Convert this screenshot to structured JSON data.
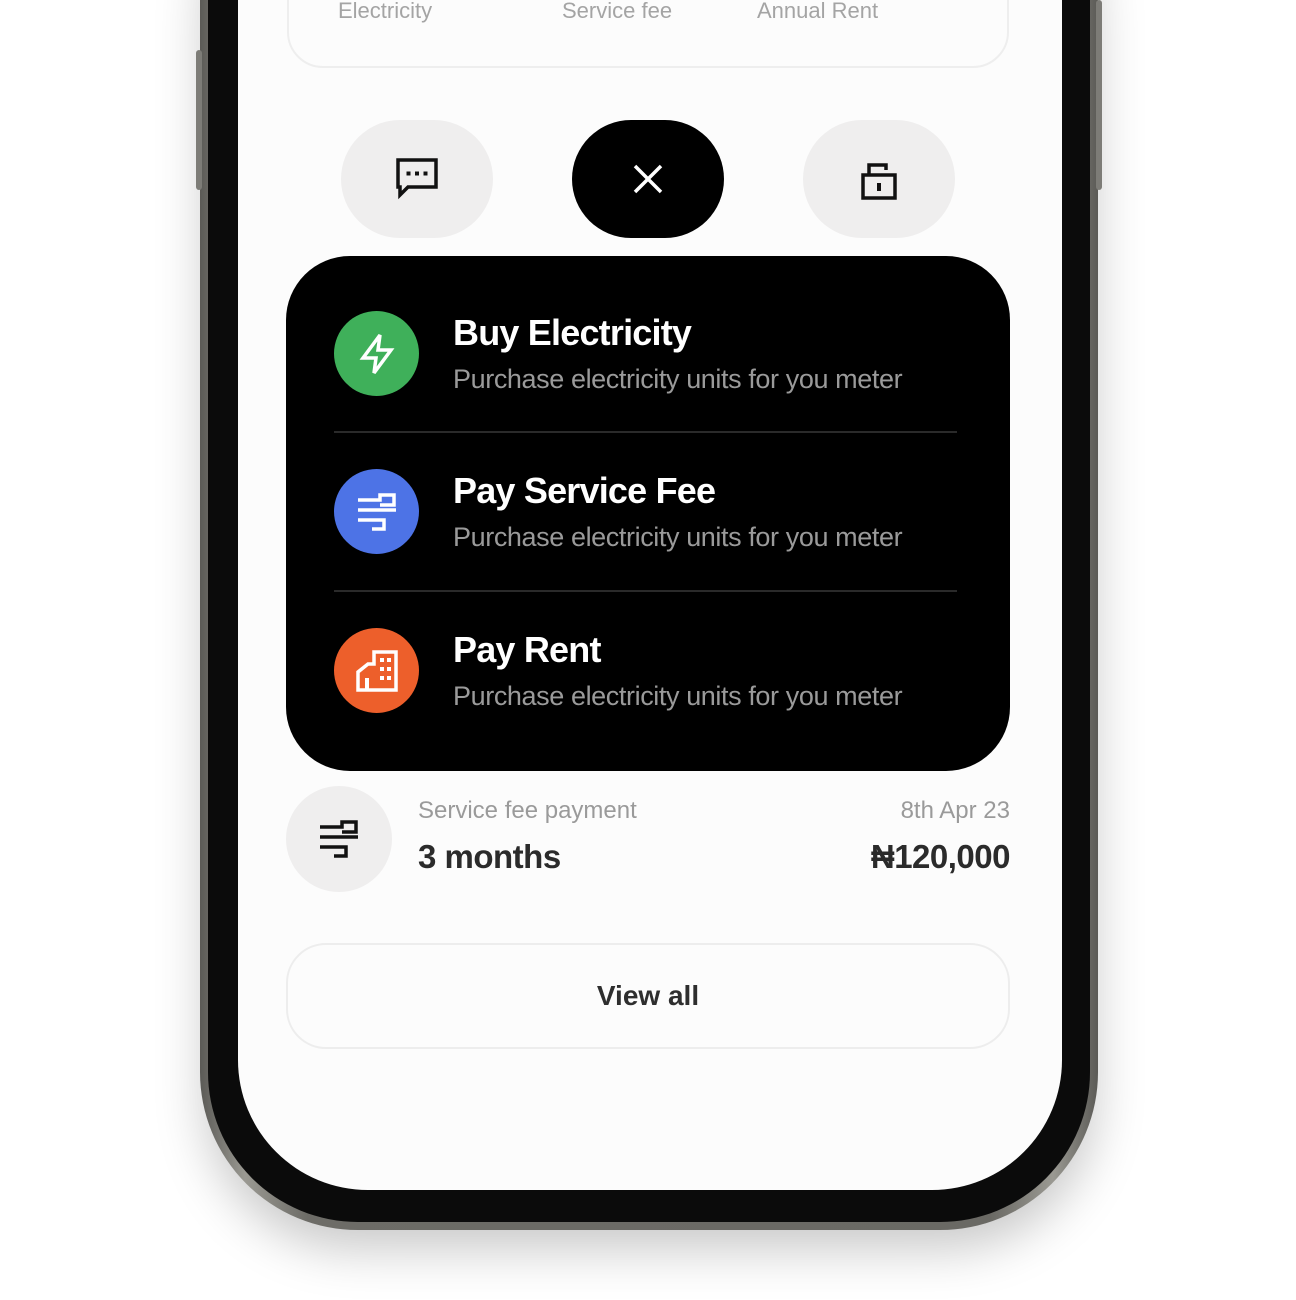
{
  "summary": {
    "labels": [
      "Electricity",
      "Service fee",
      "Annual Rent"
    ]
  },
  "actions": [
    {
      "name": "message",
      "icon": "message-dots-icon"
    },
    {
      "name": "close",
      "icon": "close-icon"
    },
    {
      "name": "lock",
      "icon": "unlock-icon"
    }
  ],
  "menu": {
    "items": [
      {
        "title": "Buy Electricity",
        "subtitle": "Purchase electricity units for you meter",
        "icon": "lightning-icon",
        "color": "#3fb05a"
      },
      {
        "title": "Pay Service Fee",
        "subtitle": "Purchase electricity units for you meter",
        "icon": "wind-icon",
        "color": "#4d73e6"
      },
      {
        "title": "Pay Rent",
        "subtitle": "Purchase electricity units for you meter",
        "icon": "building-icon",
        "color": "#ed5f2b"
      }
    ]
  },
  "transaction": {
    "label": "Service fee payment",
    "period": "3 months",
    "date": "8th Apr 23",
    "amount": "₦120,000",
    "icon": "wind-icon"
  },
  "view_all_label": "View all",
  "colors": {
    "card_bg": "#000000",
    "screen_bg": "#fcfcfc",
    "muted_text": "#9a9a9a",
    "pill_bg": "#efeeee"
  }
}
